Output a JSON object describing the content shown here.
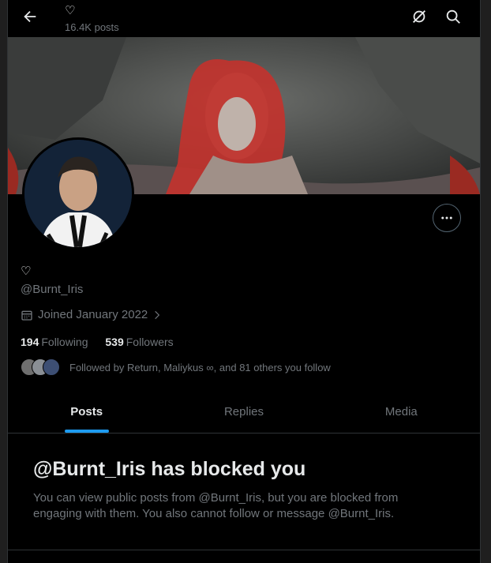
{
  "header": {
    "display_name": "♡",
    "posts_count": "16.4K posts"
  },
  "profile": {
    "display_name": "♡",
    "handle": "@Burnt_Iris",
    "joined": "Joined January 2022",
    "following_count": "194",
    "following_label": "Following",
    "followers_count": "539",
    "followers_label": "Followers",
    "followed_by": "Followed by Return, Maliykus ∞, and 81 others you follow"
  },
  "tabs": [
    {
      "label": "Posts",
      "active": true
    },
    {
      "label": "Replies",
      "active": false
    },
    {
      "label": "Media",
      "active": false
    }
  ],
  "blocked": {
    "title": "@Burnt_Iris has blocked you",
    "message": "You can view public posts from @Burnt_Iris, but you are blocked from engaging with them. You also cannot follow or message @Burnt_Iris."
  },
  "icons": [
    "back-arrow-icon",
    "grok-icon",
    "search-icon",
    "more-options-icon",
    "calendar-icon",
    "chevron-right-icon"
  ],
  "colors": {
    "accent": "#1d9bf0",
    "background": "#000000",
    "muted_text": "#71767b",
    "text": "#e7e9ea",
    "border": "#2f3336"
  }
}
